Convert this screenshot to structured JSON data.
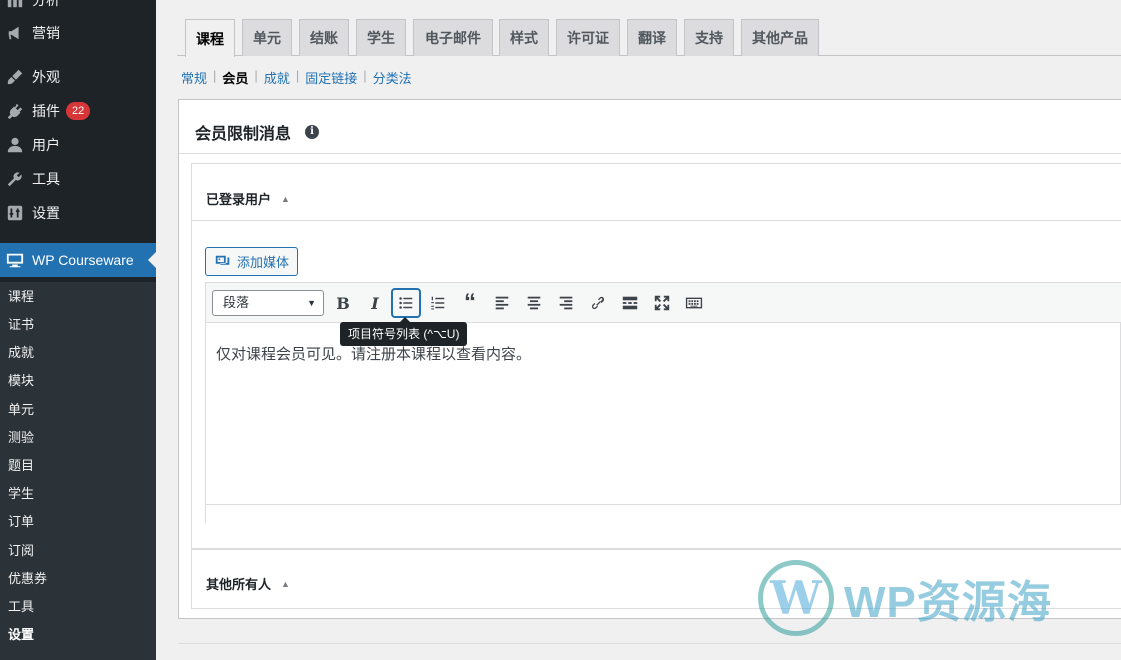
{
  "sidebar": {
    "top_items": [
      {
        "label": "分析",
        "icon": "chart-icon"
      },
      {
        "label": "营销",
        "icon": "megaphone-icon"
      },
      {
        "label": "外观",
        "icon": "paintbrush-icon"
      },
      {
        "label": "插件",
        "icon": "plugin-icon",
        "badge": "22"
      },
      {
        "label": "用户",
        "icon": "user-icon"
      },
      {
        "label": "工具",
        "icon": "wrench-icon"
      },
      {
        "label": "设置",
        "icon": "settings-icon"
      },
      {
        "label": "WP Courseware",
        "icon": "monitor-icon"
      }
    ],
    "submenu": [
      "课程",
      "证书",
      "成就",
      "模块",
      "单元",
      "测验",
      "题目",
      "学生",
      "订单",
      "订阅",
      "优惠券",
      "工具",
      "设置"
    ]
  },
  "tabs": [
    "课程",
    "单元",
    "结账",
    "学生",
    "电子邮件",
    "样式",
    "许可证",
    "翻译",
    "支持",
    "其他产品"
  ],
  "subnav": [
    "常规",
    "会员",
    "成就",
    "固定链接",
    "分类法"
  ],
  "panel": {
    "title": "会员限制消息",
    "info_icon": "i",
    "group1_title": "已登录用户",
    "group2_title": "其他所有人",
    "caret": "▲"
  },
  "editor": {
    "add_media": "添加媒体",
    "format_select": "段落",
    "tooltip": "项目符号列表 (^⌥U)",
    "content": "仅对课程会员可见。请注册本课程以查看内容。"
  },
  "watermark": {
    "logo_letter": "W",
    "text": "WP资源海"
  },
  "colors": {
    "sidebar_bg": "#1d2327",
    "accent": "#2271b1",
    "badge": "#d63638"
  }
}
